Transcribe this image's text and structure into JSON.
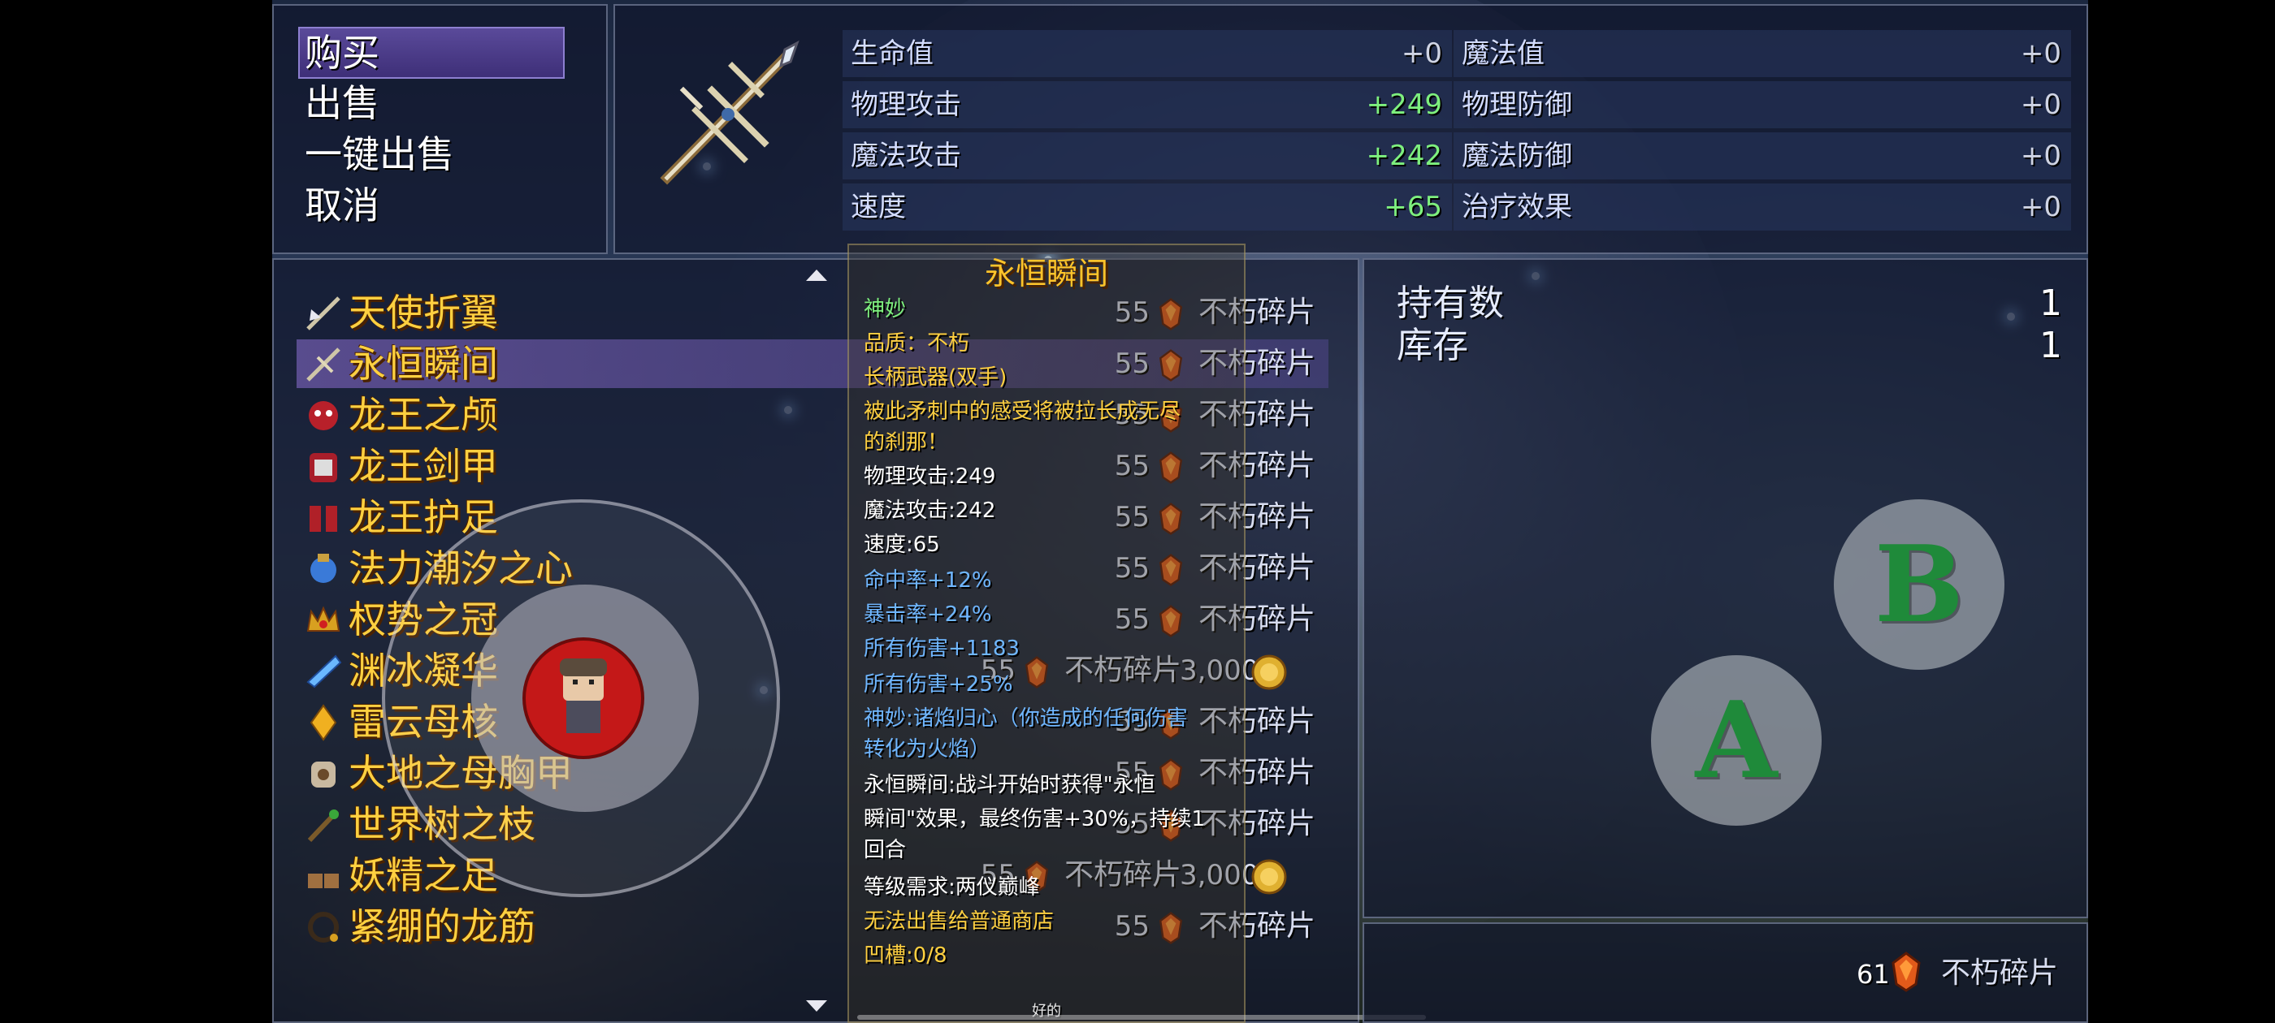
{
  "command_menu": {
    "items": [
      {
        "label": "购买",
        "selected": true
      },
      {
        "label": "出售",
        "selected": false
      },
      {
        "label": "一键出售",
        "selected": false
      },
      {
        "label": "取消",
        "selected": false
      }
    ]
  },
  "stats": {
    "rows": [
      {
        "left": {
          "name": "生命值",
          "value": "+0"
        },
        "right": {
          "name": "魔法值",
          "value": "+0"
        }
      },
      {
        "left": {
          "name": "物理攻击",
          "value": "+249"
        },
        "right": {
          "name": "物理防御",
          "value": "+0"
        }
      },
      {
        "left": {
          "name": "魔法攻击",
          "value": "+242"
        },
        "right": {
          "name": "魔法防御",
          "value": "+0"
        }
      },
      {
        "left": {
          "name": "速度",
          "value": "+65"
        },
        "right": {
          "name": "治疗效果",
          "value": "+0"
        }
      }
    ]
  },
  "shop_list": {
    "items": [
      {
        "name": "天使折翼",
        "icon": "winged-spear-icon",
        "price": "55",
        "currency": "不朽碎片"
      },
      {
        "name": "永恒瞬间",
        "icon": "spear-icon",
        "price": "55",
        "currency": "不朽碎片",
        "selected": true
      },
      {
        "name": "龙王之颅",
        "icon": "dragon-skull-icon",
        "price": "55",
        "currency": "不朽碎片"
      },
      {
        "name": "龙王剑甲",
        "icon": "dragon-armor-icon",
        "price": "55",
        "currency": "不朽碎片"
      },
      {
        "name": "龙王护足",
        "icon": "dragon-boots-icon",
        "price": "55",
        "currency": "不朽碎片"
      },
      {
        "name": "法力潮汐之心",
        "icon": "mana-orb-icon",
        "price": "55",
        "currency": "不朽碎片"
      },
      {
        "name": "权势之冠",
        "icon": "crown-icon",
        "price": "55",
        "currency": "不朽碎片"
      },
      {
        "name": "渊冰凝华",
        "icon": "ice-crystal-icon",
        "price": "55",
        "currency": "不朽碎片",
        "extra_price": "3,000"
      },
      {
        "name": "雷云母核",
        "icon": "thunder-core-icon",
        "price": "55",
        "currency": "不朽碎片"
      },
      {
        "name": "大地之母胸甲",
        "icon": "earth-breastplate-icon",
        "price": "55",
        "currency": "不朽碎片"
      },
      {
        "name": "世界树之枝",
        "icon": "branch-icon",
        "price": "55",
        "currency": "不朽碎片"
      },
      {
        "name": "妖精之足",
        "icon": "fairy-boots-icon",
        "price": "55",
        "currency": "不朽碎片",
        "extra_price": "3,000"
      },
      {
        "name": "紧绷的龙筋",
        "icon": "dragon-sinew-icon",
        "price": "55",
        "currency": "不朽碎片"
      }
    ]
  },
  "detail": {
    "title": "永恒瞬间",
    "lines": [
      {
        "text": "神妙",
        "color": "#7ef07e"
      },
      {
        "text": "品质：不朽",
        "color": "#ffd040"
      },
      {
        "text": "长柄武器(双手)",
        "color": "#ffd040"
      },
      {
        "text": "被此矛刺中的感受将被拉长成无尽",
        "color": "#ffd040"
      },
      {
        "text": "的刹那！",
        "color": "#ffd040"
      },
      {
        "text": "物理攻击:249",
        "color": "#ffffff"
      },
      {
        "text": "魔法攻击:242",
        "color": "#ffffff"
      },
      {
        "text": "速度:65",
        "color": "#ffffff"
      },
      {
        "text": "命中率+12%",
        "color": "#6fb6ff"
      },
      {
        "text": "暴击率+24%",
        "color": "#6fb6ff"
      },
      {
        "text": "所有伤害+1183",
        "color": "#6fb6ff"
      },
      {
        "text": "所有伤害+25%",
        "color": "#6fb6ff"
      },
      {
        "text": "神妙:诸焰归心（你造成的任何伤害",
        "color": "#6fb6ff"
      },
      {
        "text": "转化为火焰）",
        "color": "#6fb6ff"
      },
      {
        "text": "永恒瞬间:战斗开始时获得\"永恒",
        "color": "#ffffff"
      },
      {
        "text": "瞬间\"效果，最终伤害+30%，持续1",
        "color": "#ffffff"
      },
      {
        "text": "回合",
        "color": "#ffffff"
      },
      {
        "text": "等级需求:两仪巅峰",
        "color": "#ffffff"
      },
      {
        "text": "无法出售给普通商店",
        "color": "#ffd040"
      },
      {
        "text": "凹槽:0/8",
        "color": "#ffd040"
      }
    ],
    "footer": "好的"
  },
  "inventory": {
    "owned_label": "持有数",
    "owned_value": "1",
    "stock_label": "库存",
    "stock_value": "1"
  },
  "wallet": {
    "amount": "61",
    "currency": "不朽碎片"
  },
  "controls": {
    "a_label": "A",
    "b_label": "B"
  },
  "colors": {
    "item_name": "#ffd040",
    "stat_positive": "#7ef07e",
    "selection": "#5a4a9a"
  }
}
